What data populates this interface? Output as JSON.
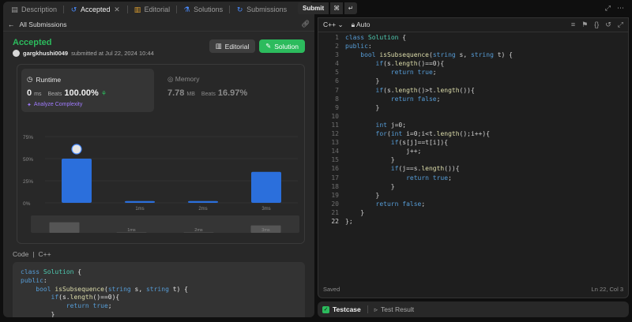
{
  "tabs": [
    {
      "label": "Description",
      "icon": "file-icon",
      "active": false
    },
    {
      "label": "Accepted",
      "icon": "history-icon",
      "active": true
    },
    {
      "label": "Editorial",
      "icon": "book-icon",
      "active": false
    },
    {
      "label": "Solutions",
      "icon": "flask-icon",
      "active": false
    },
    {
      "label": "Submissions",
      "icon": "clock-icon",
      "active": false
    }
  ],
  "topbar": {
    "submit_label": "Submit",
    "shortcut1": "⌘",
    "shortcut2": "↵"
  },
  "left_header": {
    "back_label": "All Submissions"
  },
  "status": {
    "title": "Accepted",
    "user": "gargkhushi0049",
    "submitted_text": "submitted at Jul 22, 2024 10:44",
    "editorial_label": "Editorial",
    "solution_label": "Solution"
  },
  "runtime": {
    "label": "Runtime",
    "value": "0",
    "unit": "ms",
    "beats_label": "Beats",
    "beats_value": "100.00%",
    "analyze_label": "Analyze Complexity"
  },
  "memory": {
    "label": "Memory",
    "value": "7.78",
    "unit": "MB",
    "beats_label": "Beats",
    "beats_value": "16.97%"
  },
  "chart_data": {
    "type": "bar",
    "y_ticks": [
      "75%",
      "50%",
      "25%",
      "0%"
    ],
    "ylim": [
      0,
      75
    ],
    "categories": [
      "",
      "1ms",
      "2ms",
      "3ms"
    ],
    "values": [
      50,
      2,
      2,
      35
    ],
    "highlight_index": 0,
    "colors": {
      "bar": "#2b6fdc",
      "grid": "#3d3d3d",
      "tick": "#8a8a8a"
    }
  },
  "code_section": {
    "code_label": "Code",
    "lang_label": "C++",
    "preview_lines": [
      "class Solution {",
      "public:",
      "    bool isSubsequence(string s, string t) {",
      "        if(s.length()==0){",
      "            return true;",
      "        }",
      "        if(s.length()>t.length()){",
      "            return false;"
    ]
  },
  "editor": {
    "language": "C++",
    "mode": "Auto",
    "saved_label": "Saved",
    "cursor_pos": "Ln 22, Col 3",
    "lines": [
      "class Solution {",
      "public:",
      "    bool isSubsequence(string s, string t) {",
      "        if(s.length()==0){",
      "            return true;",
      "        }",
      "        if(s.length()>t.length()){",
      "            return false;",
      "        }",
      "",
      "        int j=0;",
      "        for(int i=0;i<t.length();i++){",
      "            if(s[j]==t[i]){",
      "                j++;",
      "            }",
      "            if(j==s.length()){",
      "                return true;",
      "            }",
      "        }",
      "        return false;",
      "    }",
      "};"
    ]
  },
  "bottom": {
    "testcase_label": "Testcase",
    "result_label": "Test Result"
  }
}
